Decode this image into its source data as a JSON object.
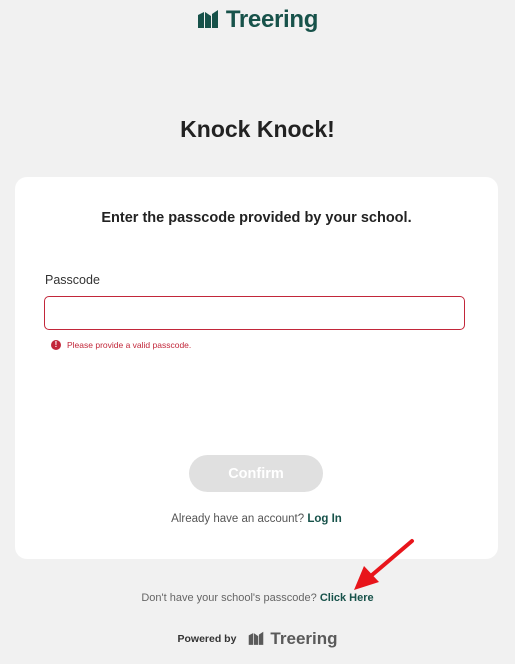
{
  "header": {
    "brand": "Treering",
    "icon": "treering-logo-icon"
  },
  "page": {
    "title": "Knock Knock!"
  },
  "card": {
    "instruction": "Enter the passcode provided by your school.",
    "passcode_label": "Passcode",
    "passcode_value": "",
    "passcode_placeholder": "",
    "error_message": "Please provide a valid passcode.",
    "confirm_label": "Confirm",
    "account_prompt": "Already have an account?",
    "login_label": "Log In"
  },
  "footer": {
    "help_prompt": "Don't have your school's passcode?",
    "click_here_label": "Click Here",
    "powered_by": "Powered by",
    "brand": "Treering"
  },
  "colors": {
    "brand_green": "#17524a",
    "error_red": "#c2273a",
    "background": "#f1f1f1",
    "button_disabled": "#e0e0e0",
    "annotation_arrow": "#e8151b"
  }
}
